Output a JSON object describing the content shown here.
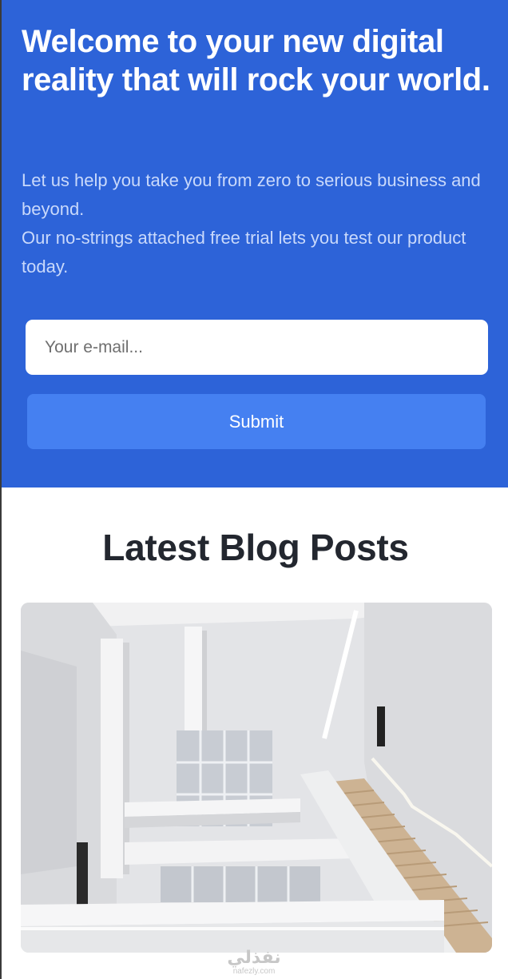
{
  "hero": {
    "title": "Welcome to your new digital reality that will rock your world.",
    "subtitle_lines": [
      "Let us help you take you from zero to serious business and beyond.",
      "Our no-strings attached free trial lets you test our product today."
    ],
    "email_placeholder": "Your e-mail...",
    "email_value": "",
    "submit_label": "Submit",
    "colors": {
      "background": "#2d63d8",
      "button": "#4580f1",
      "subtitle": "#c9d9fb"
    }
  },
  "blog": {
    "heading": "Latest Blog Posts",
    "featured_image": "interior-staircase-photo"
  },
  "watermark": {
    "brand": "نفذلي",
    "url": "nafezly.com"
  }
}
